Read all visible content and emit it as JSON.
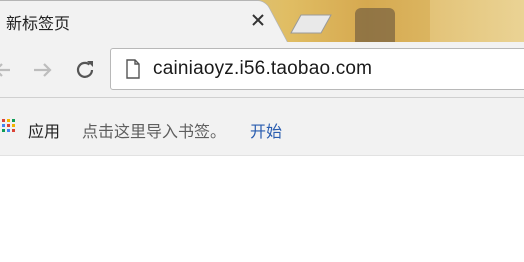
{
  "tab": {
    "title": "新标签页"
  },
  "address_bar": {
    "url": "cainiaoyz.i56.taobao.com"
  },
  "bookmarks_bar": {
    "apps_label": "应用",
    "hint": "点击这里导入书签。",
    "start_link": "开始"
  },
  "colors": {
    "toolbar_bg": "#f2f2f2",
    "link": "#2a5db0",
    "apps_grid": [
      "#db4437",
      "#f4b400",
      "#0f9d58",
      "#4285f4",
      "#db4437",
      "#f4b400",
      "#0f9d58",
      "#4285f4",
      "#db4437"
    ]
  },
  "icons": {
    "close": "close-icon",
    "back": "back-arrow-icon",
    "forward": "forward-arrow-icon",
    "reload": "reload-icon",
    "page": "page-icon",
    "apps": "apps-grid-icon"
  }
}
